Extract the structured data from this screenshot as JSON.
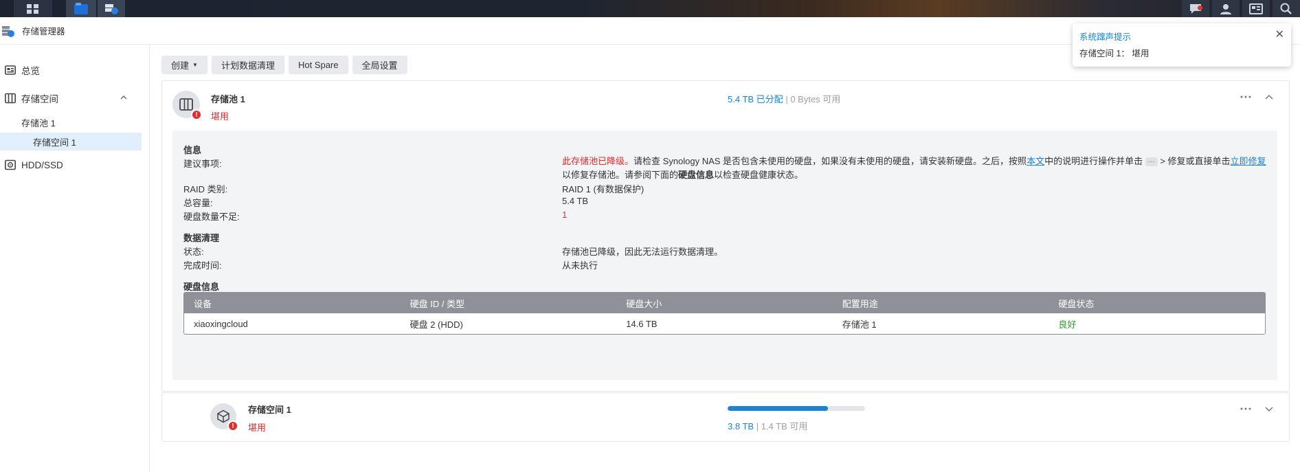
{
  "app": {
    "title": "存储管理器"
  },
  "sidebar": {
    "items": [
      {
        "label": "总览",
        "icon": "overview-icon"
      },
      {
        "label": "存储空间",
        "icon": "storage-icon"
      },
      {
        "label": "存储池 1"
      },
      {
        "label": "存储空间 1"
      },
      {
        "label": "HDD/SSD",
        "icon": "hdd-icon"
      }
    ]
  },
  "toolbar": {
    "create_label": "创建",
    "scrub_label": "计划数据清理",
    "hotspare_label": "Hot Spare",
    "global_label": "全局设置"
  },
  "pool": {
    "name": "存储池 1",
    "state": "堪用",
    "allocated": "5.4 TB 已分配",
    "separator": "|",
    "available": "0 Bytes 可用"
  },
  "info": {
    "section_title": "信息",
    "advice_label": "建议事项:",
    "advice": {
      "part1": "此存储池已降级。",
      "part2": "请检查 Synology NAS 是否包含未使用的硬盘，如果没有未使用的硬盘，请安装新硬盘。之后，按照",
      "link1": "本文",
      "part3": "中的说明进行操作并单击",
      "chip": "···",
      "part4": " > 修复或直接单击",
      "link2": "立即修复",
      "part5": "以修复存储池。请参阅下面的",
      "bold": "硬盘信息",
      "part6": "以检查硬盘健康状态。"
    },
    "raid_label": "RAID 类别:",
    "raid_value": "RAID 1 (有数据保护)",
    "capacity_label": "总容量:",
    "capacity_value": "5.4 TB",
    "missing_label": "硬盘数量不足:",
    "missing_value": "1"
  },
  "scrub": {
    "section_title": "数据清理",
    "status_label": "状态:",
    "status_value": "存储池已降级，因此无法运行数据清理。",
    "time_label": "完成时间:",
    "time_value": "从未执行"
  },
  "disks": {
    "section_title": "硬盘信息",
    "headers": [
      "设备",
      "硬盘 ID / 类型",
      "硬盘大小",
      "配置用途",
      "硬盘状态"
    ],
    "rows": [
      [
        "xiaoxingcloud",
        "硬盘 2 (HDD)",
        "14.6 TB",
        "存储池 1",
        "良好"
      ]
    ]
  },
  "volume": {
    "name": "存储空间 1",
    "state": "堪用",
    "used": "3.8 TB",
    "separator": "|",
    "free": "1.4 TB 可用",
    "usage_fraction": 0.73
  },
  "notification": {
    "title": "系统蹿声提示",
    "body": "存储空间 1： 堪用"
  },
  "colors": {
    "accent": "#1a83d4",
    "danger": "#e02d2d",
    "success": "#2e9b2e"
  }
}
